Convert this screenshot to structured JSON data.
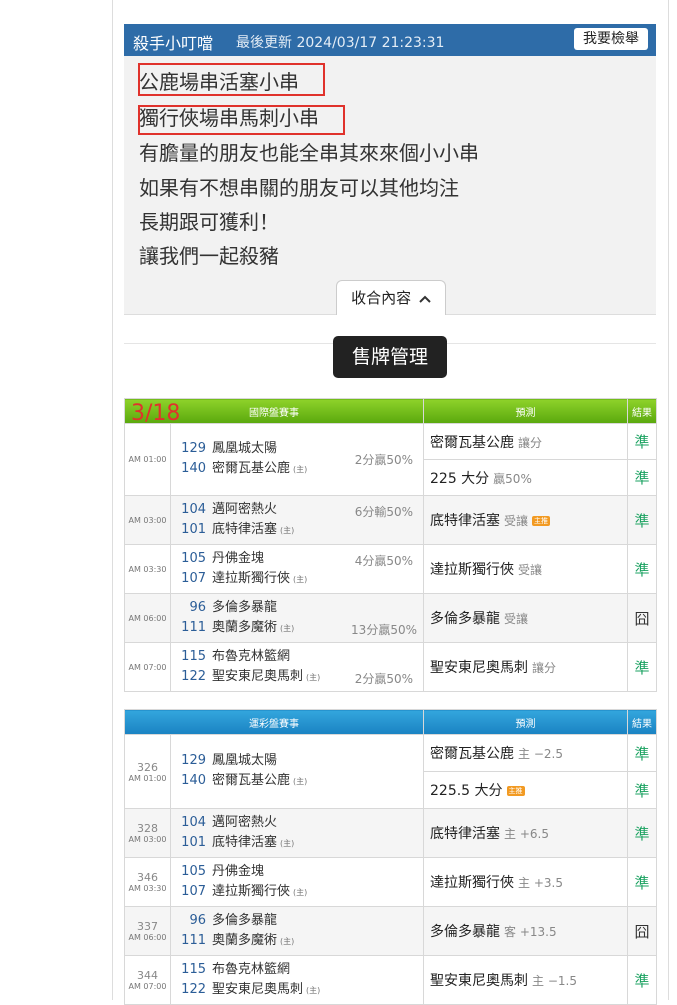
{
  "post": {
    "author": "殺手小叮噹",
    "updated": "最後更新 2024/03/17 21:23:31",
    "report": "我要檢舉",
    "lines": [
      "公鹿場串活塞小串",
      "獨行俠場串馬刺小串",
      "有膽量的朋友也能全串其來來個小小串",
      "如果有不想串關的朋友可以其他均注",
      "長期跟可獲利！",
      "讓我們一起殺豬"
    ],
    "collapse": "收合內容",
    "collapse_icon": "chevron-up-icon"
  },
  "sell_button": "售牌管理",
  "intl": {
    "date_tag": "3/18",
    "headers": [
      "國際盤賽事",
      "預測",
      "結果"
    ],
    "games": [
      {
        "time": "AM 01:00",
        "away_no": "129",
        "away": "鳳凰城太陽",
        "home_no": "140",
        "home": "密爾瓦基公鹿",
        "home_tag": "(主)",
        "spread": "2分贏50%",
        "picks": [
          {
            "text": "密爾瓦基公鹿",
            "sub": "讓分",
            "result": "準"
          },
          {
            "text": "225 大分",
            "sub": "贏50%",
            "result": "準"
          }
        ]
      },
      {
        "time": "AM 03:00",
        "away_no": "104",
        "away": "邁阿密熱火",
        "home_no": "101",
        "home": "底特律活塞",
        "home_tag": "(主)",
        "spread": "6分輸50%",
        "picks": [
          {
            "text": "底特律活塞",
            "sub": "受讓",
            "badge": "主推",
            "result": "準"
          }
        ]
      },
      {
        "time": "AM 03:30",
        "away_no": "105",
        "away": "丹佛金塊",
        "home_no": "107",
        "home": "達拉斯獨行俠",
        "home_tag": "(主)",
        "spread": "4分贏50%",
        "picks": [
          {
            "text": "達拉斯獨行俠",
            "sub": "受讓",
            "result": "準"
          }
        ]
      },
      {
        "time": "AM 06:00",
        "away_no": "96",
        "away": "多倫多暴龍",
        "home_no": "111",
        "home": "奧蘭多魔術",
        "home_tag": "(主)",
        "spread": "13分贏50%",
        "picks": [
          {
            "text": "多倫多暴龍",
            "sub": "受讓",
            "result": "囧"
          }
        ]
      },
      {
        "time": "AM 07:00",
        "away_no": "115",
        "away": "布魯克林籃網",
        "home_no": "122",
        "home": "聖安東尼奧馬刺",
        "home_tag": "(主)",
        "spread": "2分贏50%",
        "picks": [
          {
            "text": "聖安東尼奧馬刺",
            "sub": "讓分",
            "result": "準"
          }
        ]
      }
    ]
  },
  "lottery": {
    "headers": [
      "運彩盤賽事",
      "預測",
      "結果"
    ],
    "games": [
      {
        "id": "326",
        "time": "AM 01:00",
        "away_no": "129",
        "away": "鳳凰城太陽",
        "home_no": "140",
        "home": "密爾瓦基公鹿",
        "home_tag": "(主)",
        "picks": [
          {
            "text": "密爾瓦基公鹿",
            "sub": "主 −2.5",
            "result": "準"
          },
          {
            "text": "225.5 大分",
            "badge": "主推",
            "result": "準"
          }
        ]
      },
      {
        "id": "328",
        "time": "AM 03:00",
        "away_no": "104",
        "away": "邁阿密熱火",
        "home_no": "101",
        "home": "底特律活塞",
        "home_tag": "(主)",
        "picks": [
          {
            "text": "底特律活塞",
            "sub": "主 +6.5",
            "result": "準"
          }
        ]
      },
      {
        "id": "346",
        "time": "AM 03:30",
        "away_no": "105",
        "away": "丹佛金塊",
        "home_no": "107",
        "home": "達拉斯獨行俠",
        "home_tag": "(主)",
        "picks": [
          {
            "text": "達拉斯獨行俠",
            "sub": "主 +3.5",
            "result": "準"
          }
        ]
      },
      {
        "id": "337",
        "time": "AM 06:00",
        "away_no": "96",
        "away": "多倫多暴龍",
        "home_no": "111",
        "home": "奧蘭多魔術",
        "home_tag": "(主)",
        "picks": [
          {
            "text": "多倫多暴龍",
            "sub": "客 +13.5",
            "result": "囧"
          }
        ]
      },
      {
        "id": "344",
        "time": "AM 07:00",
        "away_no": "115",
        "away": "布魯克林籃網",
        "home_no": "122",
        "home": "聖安東尼奧馬刺",
        "home_tag": "(主)",
        "picks": [
          {
            "text": "聖安東尼奧馬刺",
            "sub": "主 −1.5",
            "result": "準"
          }
        ]
      }
    ]
  }
}
